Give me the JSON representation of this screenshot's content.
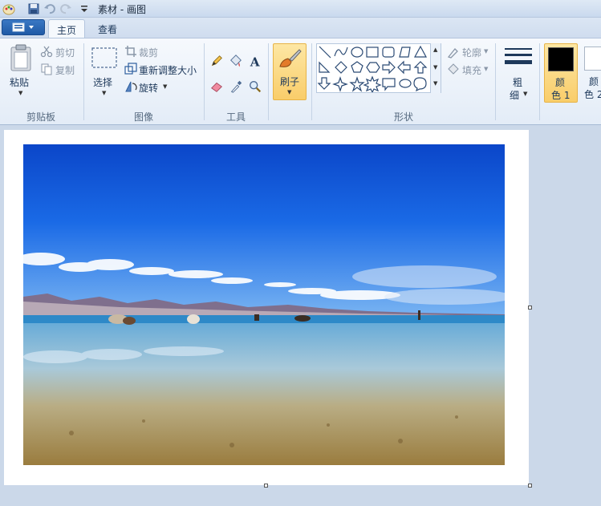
{
  "window": {
    "title": "素材 - 画图"
  },
  "tabs": [
    {
      "label": "主页",
      "active": true
    },
    {
      "label": "查看",
      "active": false
    }
  ],
  "clipboard": {
    "paste_label": "粘贴",
    "cut_label": "剪切",
    "copy_label": "复制",
    "group_label": "剪贴板"
  },
  "image": {
    "select_label": "选择",
    "crop_label": "裁剪",
    "resize_label": "重新调整大小",
    "rotate_label": "旋转",
    "group_label": "图像"
  },
  "tools": {
    "group_label": "工具",
    "text_glyph": "A"
  },
  "brushes": {
    "label": "刷子"
  },
  "shapes": {
    "outline_label": "轮廓",
    "fill_label": "填充",
    "group_label": "形状"
  },
  "size": {
    "label_line1": "粗",
    "label_line2": "细"
  },
  "colors": {
    "color1_line1": "颜",
    "color1_line2": "色 1",
    "color2_line1": "颜",
    "color2_line2": "色 2",
    "color1_value": "#000000",
    "color2_value": "#ffffff"
  },
  "theme": {
    "accent": "#1f5aa6",
    "ribbon_bg": "#eef3fa",
    "workspace_bg": "#cbd8e9",
    "selected_orange": "#f9cd6a"
  }
}
